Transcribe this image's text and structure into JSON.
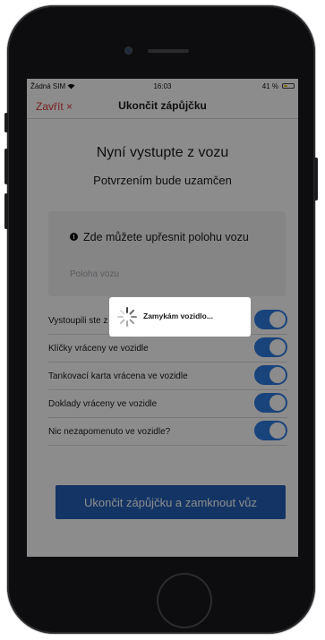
{
  "status_bar": {
    "carrier": "Žádná SIM",
    "wifi_icon": "wifi-icon",
    "time": "16:03",
    "battery_percent": "41 %",
    "battery_level": 0.41,
    "battery_color": "#f0c400"
  },
  "nav": {
    "close_label": "Zavřít ×",
    "title": "Ukončit zápůjčku"
  },
  "main": {
    "heading": "Nyní vystupte z vozu",
    "subheading": "Potvrzením bude uzamčen",
    "location": {
      "icon": "info-icon",
      "label": "Zde můžete upřesnit polohu vozu",
      "placeholder": "Poloha vozu"
    },
    "toggles": [
      {
        "label": "Vystoupili ste z vozu",
        "on": true
      },
      {
        "label": "Klíčky vráceny ve vozidle",
        "on": true
      },
      {
        "label": "Tankovací karta vrácena ve vozidle",
        "on": true
      },
      {
        "label": "Doklady vráceny ve vozidle",
        "on": true
      },
      {
        "label": "Nic nezapomenuto ve vozidle?",
        "on": true
      }
    ],
    "submit_label": "Ukončit zápůjčku a zamknout vůz"
  },
  "loading": {
    "spinner_icon": "spinner-icon",
    "text": "Zamykám vozidlo..."
  },
  "colors": {
    "accent": "#2e7be0",
    "button": "#2460b8",
    "close": "#e03a3a"
  }
}
